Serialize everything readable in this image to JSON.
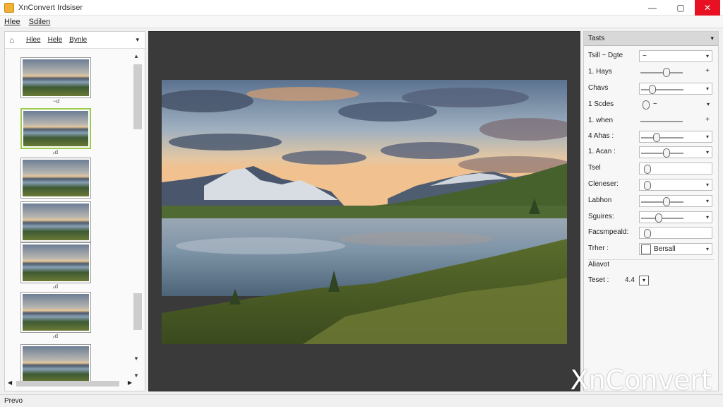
{
  "window": {
    "title": "XnConvert Irdsiser"
  },
  "window_controls": {
    "minimize": "—",
    "maximize": "▢",
    "close": "✕"
  },
  "menu": {
    "items": [
      "Hlee",
      "Sdilen"
    ]
  },
  "left_panel": {
    "toolbar": [
      "Hlee",
      "Hele",
      "Bynle"
    ],
    "dropdown_glyph": "▾",
    "thumbnails": [
      {
        "caption": "~d",
        "selected": false
      },
      {
        "caption": "ᵥd",
        "selected": true
      },
      {
        "caption": "",
        "selected": false
      },
      {
        "caption": "",
        "selected": false
      },
      {
        "caption": "ᵥd",
        "selected": false
      },
      {
        "caption": "ᵥd",
        "selected": false
      },
      {
        "caption": "",
        "selected": false
      }
    ],
    "scroll_up": "▲",
    "scroll_down": "▼",
    "scroll_left": "◀",
    "scroll_right": "▶"
  },
  "settings_panel": {
    "header": "Tasts",
    "rows": [
      {
        "label": "Tsill ~ Dgte",
        "type": "select",
        "value": "~"
      },
      {
        "label": "1. Hays",
        "type": "slider",
        "level": 0.58,
        "tail": "+"
      },
      {
        "label": "Chavs",
        "type": "slider-select",
        "level": 0.2
      },
      {
        "label": "1 Scdes",
        "type": "slider-select",
        "level": 0.05,
        "value": "~"
      },
      {
        "label": "1. when",
        "type": "slider",
        "level": 0.9,
        "tail": "+"
      },
      {
        "label": "4 Ahas :",
        "type": "slider-select",
        "level": 0.3
      },
      {
        "label": "1. Acan :",
        "type": "slider-select",
        "level": 0.55
      },
      {
        "label": "Tsel",
        "type": "textbox-knob"
      },
      {
        "label": "Cleneser:",
        "type": "select-knob"
      },
      {
        "label": "Labhon",
        "type": "slider-select",
        "level": 0.55
      },
      {
        "label": "Sguires:",
        "type": "slider-select",
        "level": 0.35
      },
      {
        "label": "Facsmpeald:",
        "type": "textbox-knob"
      },
      {
        "label": "Trher :",
        "type": "select",
        "value": "Bersall"
      }
    ],
    "section": "Aliavot",
    "last_row": {
      "label": "Teset :",
      "value": "4.4",
      "box": "▾"
    }
  },
  "status": {
    "text": "Prevo"
  },
  "watermark": "XnConvert"
}
